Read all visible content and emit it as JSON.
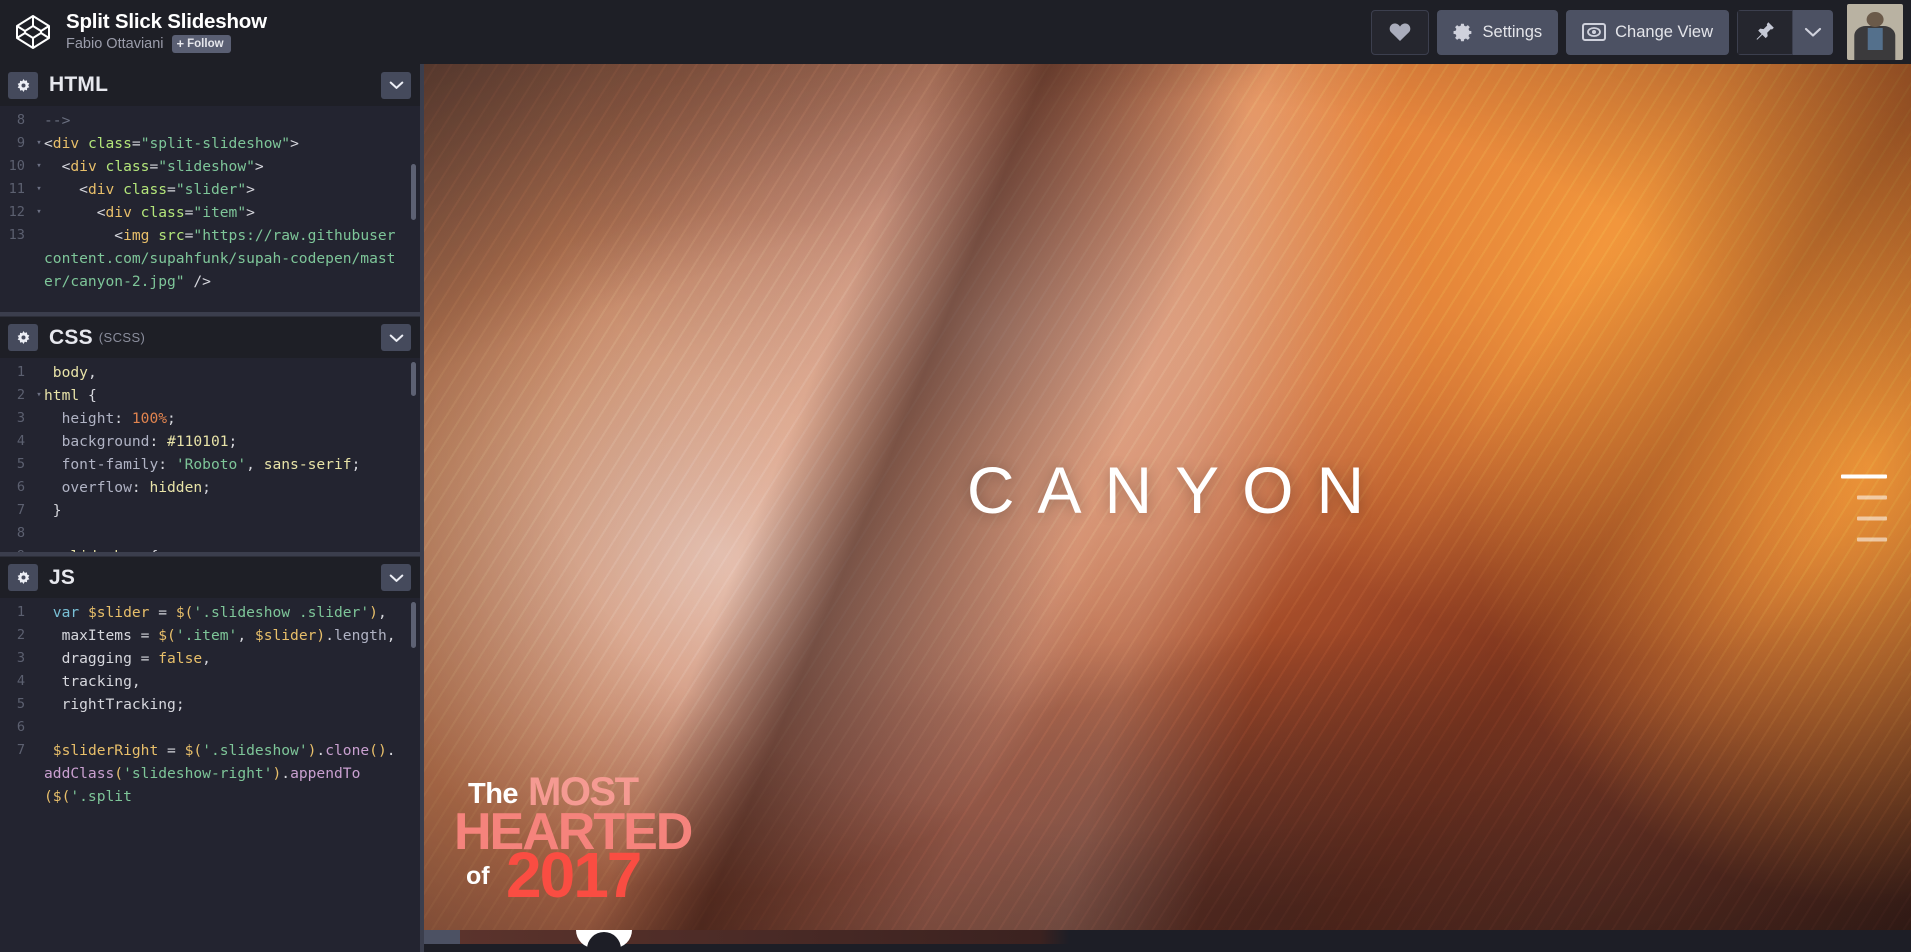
{
  "header": {
    "logo_icon": "codepen-logo-icon",
    "pen_title": "Split Slick Slideshow",
    "author": "Fabio Ottaviani",
    "follow_label": "Follow",
    "follow_plus": "+",
    "love_icon": "heart-icon",
    "settings_label": "Settings",
    "settings_icon": "gear-icon",
    "change_view_label": "Change View",
    "change_view_icon": "eye-in-box-icon",
    "pin_icon": "pushpin-icon",
    "caret_icon": "chevron-down-icon",
    "avatar_icon": "user-avatar"
  },
  "editors": [
    {
      "id": "html",
      "title": "HTML",
      "subtitle": "",
      "settings_icon": "gear-icon",
      "collapse_icon": "chevron-down-icon",
      "lines": [
        {
          "num": "8",
          "fold": "",
          "tokens": [
            {
              "t": "com",
              "s": "-->"
            }
          ]
        },
        {
          "num": "9",
          "fold": "▾",
          "tokens": [
            {
              "t": "punct",
              "s": "<"
            },
            {
              "t": "tag",
              "s": "div "
            },
            {
              "t": "attr",
              "s": "class"
            },
            {
              "t": "punct",
              "s": "="
            },
            {
              "t": "str",
              "s": "\"split-slideshow\""
            },
            {
              "t": "punct",
              "s": ">"
            }
          ]
        },
        {
          "num": "10",
          "fold": "▾",
          "tokens": [
            {
              "t": "plain",
              "s": "  "
            },
            {
              "t": "punct",
              "s": "<"
            },
            {
              "t": "tag",
              "s": "div "
            },
            {
              "t": "attr",
              "s": "class"
            },
            {
              "t": "punct",
              "s": "="
            },
            {
              "t": "str",
              "s": "\"slideshow\""
            },
            {
              "t": "punct",
              "s": ">"
            }
          ]
        },
        {
          "num": "11",
          "fold": "▾",
          "tokens": [
            {
              "t": "plain",
              "s": "    "
            },
            {
              "t": "punct",
              "s": "<"
            },
            {
              "t": "tag",
              "s": "div "
            },
            {
              "t": "attr",
              "s": "class"
            },
            {
              "t": "punct",
              "s": "="
            },
            {
              "t": "str",
              "s": "\"slider\""
            },
            {
              "t": "punct",
              "s": ">"
            }
          ]
        },
        {
          "num": "12",
          "fold": "▾",
          "tokens": [
            {
              "t": "plain",
              "s": "      "
            },
            {
              "t": "punct",
              "s": "<"
            },
            {
              "t": "tag",
              "s": "div "
            },
            {
              "t": "attr",
              "s": "class"
            },
            {
              "t": "punct",
              "s": "="
            },
            {
              "t": "str",
              "s": "\"item\""
            },
            {
              "t": "punct",
              "s": ">"
            }
          ]
        },
        {
          "num": "13",
          "fold": "",
          "tokens": [
            {
              "t": "plain",
              "s": "        "
            },
            {
              "t": "punct",
              "s": "<"
            },
            {
              "t": "tag",
              "s": "img "
            },
            {
              "t": "attr",
              "s": "src"
            },
            {
              "t": "punct",
              "s": "="
            },
            {
              "t": "str",
              "s": "\"https://raw.githubusercontent.com/supahfunk/supah-codepen/master/canyon-2.jpg\""
            },
            {
              "t": "punct",
              "s": " />"
            }
          ]
        }
      ]
    },
    {
      "id": "css",
      "title": "CSS",
      "subtitle": "(SCSS)",
      "settings_icon": "gear-icon",
      "collapse_icon": "chevron-down-icon",
      "lines": [
        {
          "num": "1",
          "fold": "",
          "tokens": [
            {
              "t": "sel",
              "s": " body"
            },
            {
              "t": "punct",
              "s": ","
            }
          ]
        },
        {
          "num": "2",
          "fold": "▾",
          "tokens": [
            {
              "t": "sel",
              "s": "html "
            },
            {
              "t": "punct",
              "s": "{"
            }
          ]
        },
        {
          "num": "3",
          "fold": "",
          "tokens": [
            {
              "t": "prop",
              "s": "  height"
            },
            {
              "t": "punct",
              "s": ": "
            },
            {
              "t": "num",
              "s": "100%"
            },
            {
              "t": "punct",
              "s": ";"
            }
          ]
        },
        {
          "num": "4",
          "fold": "",
          "tokens": [
            {
              "t": "prop",
              "s": "  background"
            },
            {
              "t": "punct",
              "s": ": "
            },
            {
              "t": "sel",
              "s": "#110101"
            },
            {
              "t": "punct",
              "s": ";"
            }
          ]
        },
        {
          "num": "5",
          "fold": "",
          "tokens": [
            {
              "t": "prop",
              "s": "  font-family"
            },
            {
              "t": "punct",
              "s": ": "
            },
            {
              "t": "str",
              "s": "'Roboto'"
            },
            {
              "t": "punct",
              "s": ", "
            },
            {
              "t": "sel",
              "s": "sans-serif"
            },
            {
              "t": "punct",
              "s": ";"
            }
          ]
        },
        {
          "num": "6",
          "fold": "",
          "tokens": [
            {
              "t": "prop",
              "s": "  overflow"
            },
            {
              "t": "punct",
              "s": ": "
            },
            {
              "t": "sel",
              "s": "hidden"
            },
            {
              "t": "punct",
              "s": ";"
            }
          ]
        },
        {
          "num": "7",
          "fold": "",
          "tokens": [
            {
              "t": "punct",
              "s": " }"
            }
          ]
        },
        {
          "num": "8",
          "fold": "",
          "tokens": [
            {
              "t": "plain",
              "s": ""
            }
          ]
        },
        {
          "num": "9",
          "fold": "▾",
          "tokens": [
            {
              "t": "sel",
              "s": " .slideshow "
            },
            {
              "t": "punct",
              "s": "{"
            }
          ]
        }
      ]
    },
    {
      "id": "js",
      "title": "JS",
      "subtitle": "",
      "settings_icon": "gear-icon",
      "collapse_icon": "chevron-down-icon",
      "lines": [
        {
          "num": "1",
          "fold": "",
          "tokens": [
            {
              "t": "kw",
              "s": " var "
            },
            {
              "t": "var",
              "s": "$slider "
            },
            {
              "t": "punct",
              "s": "= "
            },
            {
              "t": "dollar",
              "s": "$("
            },
            {
              "t": "str",
              "s": "'.slideshow .slider'"
            },
            {
              "t": "dollar",
              "s": ")"
            },
            {
              "t": "punct",
              "s": ","
            }
          ]
        },
        {
          "num": "2",
          "fold": "",
          "tokens": [
            {
              "t": "plain",
              "s": "  maxItems "
            },
            {
              "t": "punct",
              "s": "= "
            },
            {
              "t": "dollar",
              "s": "$("
            },
            {
              "t": "str",
              "s": "'.item'"
            },
            {
              "t": "punct",
              "s": ", "
            },
            {
              "t": "var",
              "s": "$slider"
            },
            {
              "t": "dollar",
              "s": ")"
            },
            {
              "t": "punct",
              "s": "."
            },
            {
              "t": "prop",
              "s": "length"
            },
            {
              "t": "punct",
              "s": ","
            }
          ]
        },
        {
          "num": "3",
          "fold": "",
          "tokens": [
            {
              "t": "plain",
              "s": "  dragging "
            },
            {
              "t": "punct",
              "s": "= "
            },
            {
              "t": "bool",
              "s": "false"
            },
            {
              "t": "punct",
              "s": ","
            }
          ]
        },
        {
          "num": "4",
          "fold": "",
          "tokens": [
            {
              "t": "plain",
              "s": "  tracking"
            },
            {
              "t": "punct",
              "s": ","
            }
          ]
        },
        {
          "num": "5",
          "fold": "",
          "tokens": [
            {
              "t": "plain",
              "s": "  rightTracking"
            },
            {
              "t": "punct",
              "s": ";"
            }
          ]
        },
        {
          "num": "6",
          "fold": "",
          "tokens": [
            {
              "t": "plain",
              "s": ""
            }
          ]
        },
        {
          "num": "7",
          "fold": "",
          "tokens": [
            {
              "t": "var",
              "s": " $sliderRight "
            },
            {
              "t": "punct",
              "s": "= "
            },
            {
              "t": "dollar",
              "s": "$("
            },
            {
              "t": "str",
              "s": "'.slideshow'"
            },
            {
              "t": "dollar",
              "s": ")"
            },
            {
              "t": "punct",
              "s": "."
            },
            {
              "t": "fn",
              "s": "clone"
            },
            {
              "t": "dollar",
              "s": "()"
            },
            {
              "t": "punct",
              "s": "."
            },
            {
              "t": "fn",
              "s": "addClass"
            },
            {
              "t": "dollar",
              "s": "("
            },
            {
              "t": "str",
              "s": "'slideshow-right'"
            },
            {
              "t": "dollar",
              "s": ")"
            },
            {
              "t": "punct",
              "s": "."
            },
            {
              "t": "fn",
              "s": "appendTo"
            },
            {
              "t": "dollar",
              "s": "($("
            },
            {
              "t": "str",
              "s": "'.split"
            }
          ]
        }
      ]
    }
  ],
  "preview": {
    "caption": "CANYON",
    "pager": [
      {
        "label": "slide-1",
        "active": true
      },
      {
        "label": "slide-2",
        "active": false
      },
      {
        "label": "slide-3",
        "active": false
      },
      {
        "label": "slide-4",
        "active": false
      }
    ],
    "badge": {
      "the": "The",
      "most": "MOST",
      "hearted": "HEARTED",
      "of": "of",
      "year": "2017"
    }
  },
  "colors": {
    "topbar_bg": "#1e1f26",
    "editor_bg": "#232430",
    "panel_header_bg": "#1e1f26",
    "button_bg": "#4c5163",
    "accent_red": "#fa4d42",
    "accent_pink": "#f5837c",
    "code_bg_hex": "#110101"
  }
}
